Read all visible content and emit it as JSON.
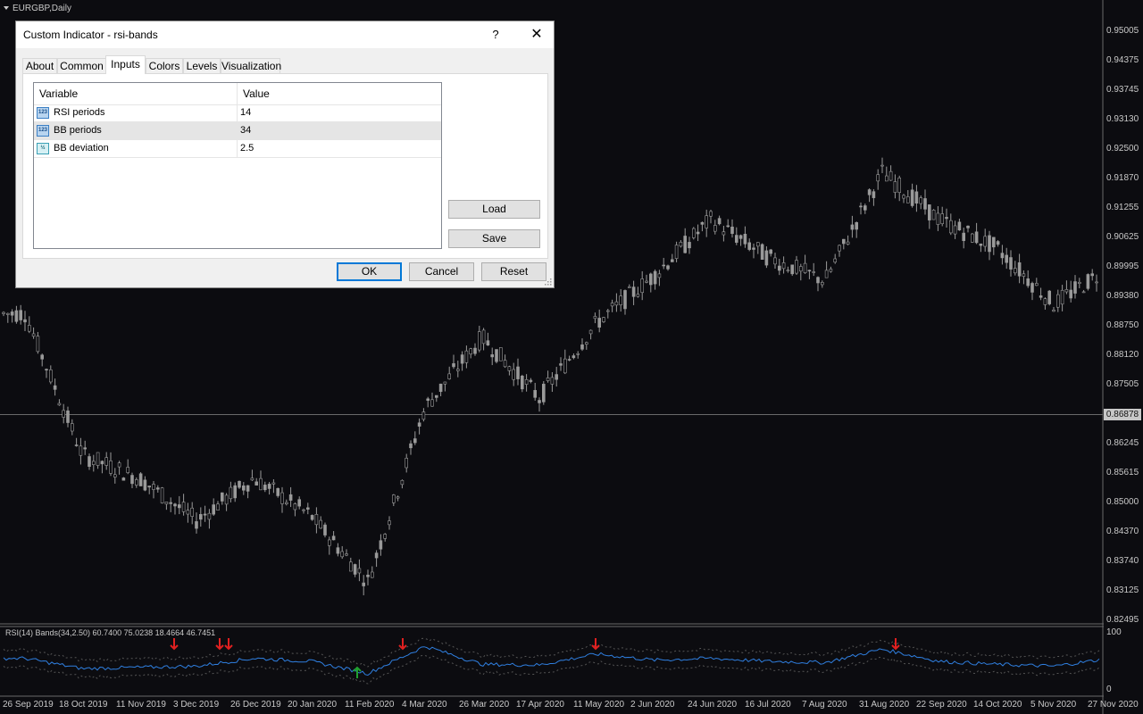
{
  "chart": {
    "symbol_title": "EURGBP,Daily",
    "current_price": "0.86878",
    "price_labels": [
      "0.95005",
      "0.94375",
      "0.93745",
      "0.93130",
      "0.92500",
      "0.91870",
      "0.91255",
      "0.90625",
      "0.89995",
      "0.89380",
      "0.88750",
      "0.88120",
      "0.87505",
      "0.86245",
      "0.85615",
      "0.85000",
      "0.84370",
      "0.83740",
      "0.83125",
      "0.82495"
    ],
    "date_labels": [
      "26 Sep 2019",
      "18 Oct 2019",
      "11 Nov 2019",
      "3 Dec 2019",
      "26 Dec 2019",
      "20 Jan 2020",
      "11 Feb 2020",
      "4 Mar 2020",
      "26 Mar 2020",
      "17 Apr 2020",
      "11 May 2020",
      "2 Jun 2020",
      "24 Jun 2020",
      "16 Jul 2020",
      "7 Aug 2020",
      "31 Aug 2020",
      "22 Sep 2020",
      "14 Oct 2020",
      "5 Nov 2020",
      "27 Nov 2020"
    ],
    "indicator_title": "RSI(14) Bands(34,2.50) 60.7400 75.0238 18.4664 46.7451",
    "indicator_levels": [
      "100",
      "0"
    ],
    "colors": {
      "background": "#0c0c10",
      "candle": "#9a9a9a",
      "rsi_line": "#2f7fe0",
      "signal_down": "#e02020",
      "signal_up": "#20a030"
    }
  },
  "chart_data": {
    "type": "candlestick",
    "series": [
      {
        "name": "price_close_approx",
        "x": [
          "26 Sep 2019",
          "18 Oct 2019",
          "11 Nov 2019",
          "3 Dec 2019",
          "26 Dec 2019",
          "20 Jan 2020",
          "11 Feb 2020",
          "4 Mar 2020",
          "26 Mar 2020",
          "17 Apr 2020",
          "11 May 2020",
          "2 Jun 2020",
          "24 Jun 2020",
          "16 Jul 2020",
          "7 Aug 2020",
          "31 Aug 2020",
          "22 Sep 2020",
          "14 Oct 2020",
          "5 Nov 2020",
          "27 Nov 2020"
        ],
        "values": [
          0.89,
          0.86,
          0.855,
          0.846,
          0.855,
          0.847,
          0.833,
          0.87,
          0.885,
          0.872,
          0.888,
          0.898,
          0.91,
          0.902,
          0.897,
          0.92,
          0.91,
          0.904,
          0.892,
          0.9
        ]
      },
      {
        "name": "RSI(14)",
        "x": [
          "26 Sep 2019",
          "18 Oct 2019",
          "11 Nov 2019",
          "3 Dec 2019",
          "26 Dec 2019",
          "20 Jan 2020",
          "11 Feb 2020",
          "4 Mar 2020",
          "26 Mar 2020",
          "17 Apr 2020",
          "11 May 2020",
          "2 Jun 2020",
          "24 Jun 2020",
          "16 Jul 2020",
          "7 Aug 2020",
          "31 Aug 2020",
          "22 Sep 2020",
          "14 Oct 2020",
          "5 Nov 2020",
          "27 Nov 2020"
        ],
        "values": [
          55,
          38,
          40,
          42,
          55,
          50,
          30,
          75,
          45,
          44,
          62,
          52,
          55,
          50,
          48,
          70,
          50,
          45,
          42,
          55
        ]
      }
    ],
    "ylim": [
      0.82495,
      0.95005
    ]
  },
  "dialog": {
    "title": "Custom Indicator - rsi-bands",
    "help": "?",
    "close": "✕",
    "tabs": [
      "About",
      "Common",
      "Inputs",
      "Colors",
      "Levels",
      "Visualization"
    ],
    "active_tab": "Inputs",
    "columns": {
      "variable": "Variable",
      "value": "Value"
    },
    "params": [
      {
        "icon": "123",
        "name": "RSI periods",
        "value": "14"
      },
      {
        "icon": "123",
        "name": "BB periods",
        "value": "34"
      },
      {
        "icon": "½",
        "name": "BB deviation",
        "value": "2.5"
      }
    ],
    "buttons": {
      "load": "Load",
      "save": "Save",
      "ok": "OK",
      "cancel": "Cancel",
      "reset": "Reset"
    }
  }
}
